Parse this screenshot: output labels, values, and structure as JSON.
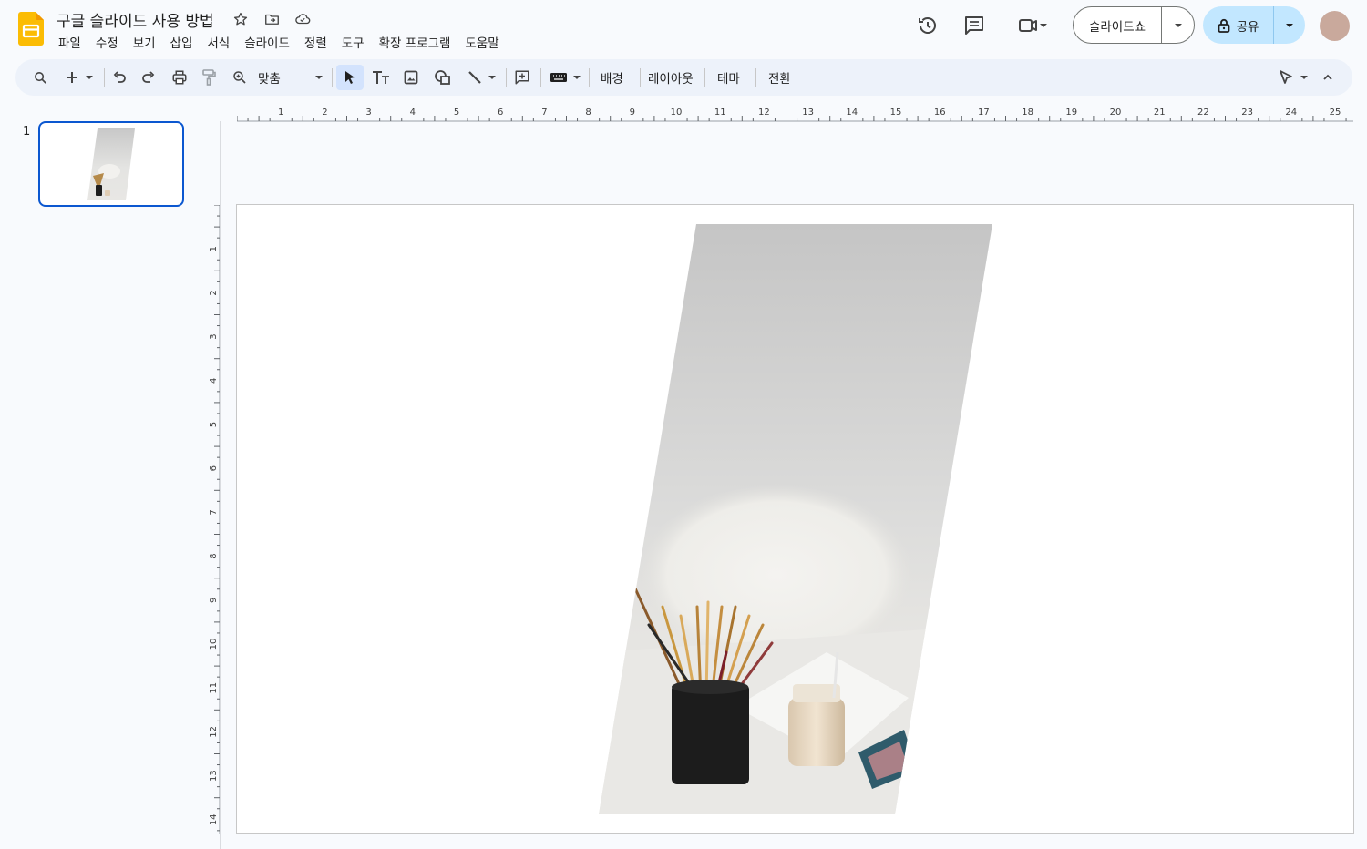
{
  "doc": {
    "title": "구글 슬라이드 사용 방법"
  },
  "menu": [
    "파일",
    "수정",
    "보기",
    "삽입",
    "서식",
    "슬라이드",
    "정렬",
    "도구",
    "확장 프로그램",
    "도움말"
  ],
  "header": {
    "slideshow_label": "슬라이드쇼",
    "share_label": "공유"
  },
  "toolbar": {
    "zoom_label": "맞춤",
    "background_label": "배경",
    "layout_label": "레이아웃",
    "theme_label": "테마",
    "transition_label": "전환"
  },
  "filmstrip": {
    "slide_number": "1"
  },
  "ruler": {
    "horizontal": [
      "1",
      "2",
      "3",
      "4",
      "5",
      "6",
      "7",
      "8",
      "9",
      "10",
      "11",
      "12",
      "13",
      "14",
      "15",
      "16",
      "17",
      "18",
      "19",
      "20",
      "21",
      "22",
      "23",
      "24",
      "25"
    ],
    "vertical": [
      "1",
      "2",
      "3",
      "4",
      "5",
      "6",
      "7",
      "8",
      "9",
      "10",
      "11",
      "12",
      "13",
      "14"
    ]
  },
  "colors": {
    "accent": "#0b57d0",
    "share_bg": "#c2e7ff",
    "toolbar_bg": "#edf2fa",
    "logo": "#fbbc04"
  }
}
